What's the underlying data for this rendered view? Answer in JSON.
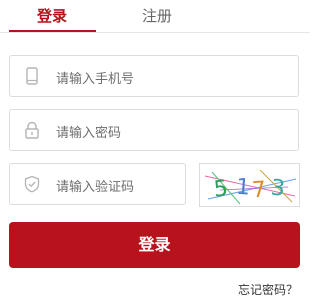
{
  "tabs": {
    "login": "登录",
    "register": "注册"
  },
  "fields": {
    "phone_placeholder": "请输入手机号",
    "password_placeholder": "请输入密码",
    "code_placeholder": "请输入验证码"
  },
  "captcha": {
    "text": "5173"
  },
  "buttons": {
    "login": "登录",
    "forgot": "忘记密码？"
  },
  "colors": {
    "accent": "#b8121d",
    "border": "#dcdcdc",
    "placeholder": "#6e6e6e"
  },
  "icons": {
    "phone": "phone-icon",
    "password": "lock-icon",
    "code": "shield-check-icon"
  }
}
